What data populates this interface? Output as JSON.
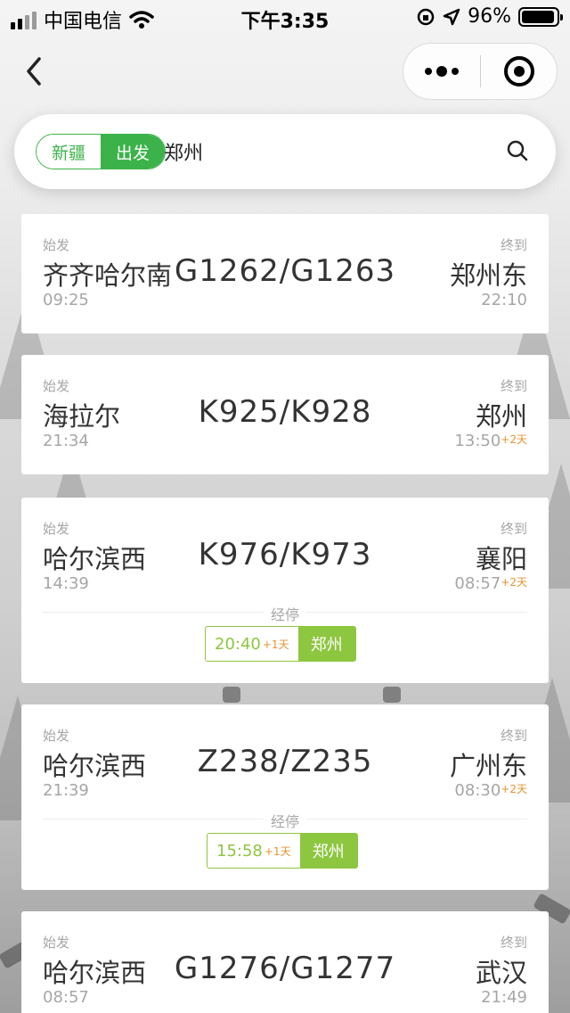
{
  "status_bar": {
    "carrier": "中国电信",
    "time": "下午3:35",
    "battery": "96%",
    "battery_level": 0.96
  },
  "search": {
    "region": "新疆",
    "mode": "出发",
    "city": "郑州"
  },
  "labels": {
    "origin": "始发",
    "terminal": "终到",
    "via": "经停"
  },
  "trains": [
    {
      "code": "G1262/G1263",
      "from": "齐齐哈尔南",
      "from_time": "09:25",
      "to": "郑州东",
      "to_time": "22:10",
      "to_day": ""
    },
    {
      "code": "K925/K928",
      "from": "海拉尔",
      "from_time": "21:34",
      "to": "郑州",
      "to_time": "13:50",
      "to_day": "+2天"
    },
    {
      "code": "K976/K973",
      "from": "哈尔滨西",
      "from_time": "14:39",
      "to": "襄阳",
      "to_time": "08:57",
      "to_day": "+2天",
      "stop": {
        "time": "20:40",
        "day": "+1天",
        "city": "郑州"
      }
    },
    {
      "code": "Z238/Z235",
      "from": "哈尔滨西",
      "from_time": "21:39",
      "to": "广州东",
      "to_time": "08:30",
      "to_day": "+2天",
      "stop": {
        "time": "15:58",
        "day": "+1天",
        "city": "郑州"
      }
    },
    {
      "code": "G1276/G1277",
      "from": "哈尔滨西",
      "from_time": "08:57",
      "to": "武汉",
      "to_time": "21:49",
      "to_day": ""
    }
  ]
}
